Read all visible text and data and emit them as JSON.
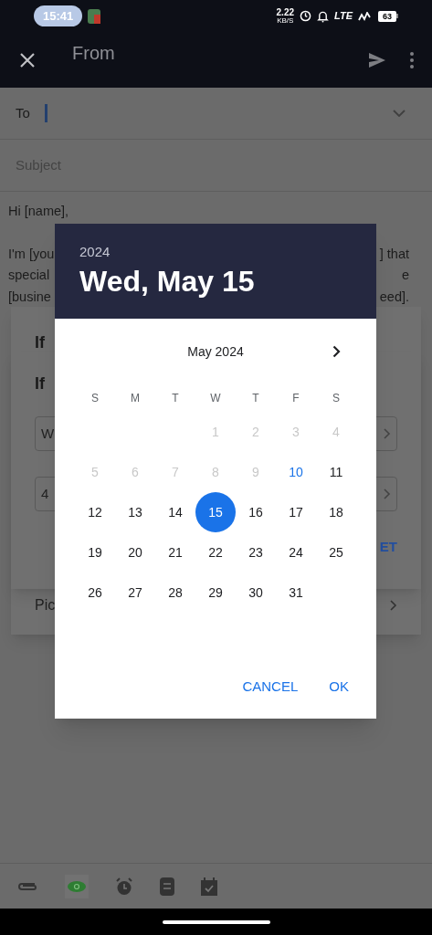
{
  "status_bar": {
    "time": "15:41",
    "speed": "2.22",
    "speed_unit": "KB/S",
    "network": "LTE",
    "battery": "63"
  },
  "app_bar": {
    "title": "From"
  },
  "compose": {
    "to_label": "To",
    "subject_placeholder": "Subject",
    "greeting": "Hi [name],",
    "body_lines": [
      {
        "left": "I'm [you",
        "right": "] that"
      },
      {
        "left": "special",
        "right": "e"
      },
      {
        "left": "[busine",
        "right": "eed]."
      }
    ]
  },
  "back_sheet": {
    "heading": "If",
    "row_label": "Pic"
  },
  "front_sheet": {
    "heading": "If",
    "fields": [
      "W",
      "4"
    ],
    "action": "ET"
  },
  "date_picker": {
    "year": "2024",
    "date": "Wed, May 15",
    "month": "May 2024",
    "weekdays": [
      "S",
      "M",
      "T",
      "W",
      "T",
      "F",
      "S"
    ],
    "weeks": [
      [
        {
          "kind": "blank"
        },
        {
          "kind": "blank"
        },
        {
          "kind": "blank"
        },
        {
          "day": "1",
          "kind": "disabled"
        },
        {
          "day": "2",
          "kind": "disabled"
        },
        {
          "day": "3",
          "kind": "disabled"
        },
        {
          "day": "4",
          "kind": "disabled"
        }
      ],
      [
        {
          "day": "5",
          "kind": "disabled"
        },
        {
          "day": "6",
          "kind": "disabled"
        },
        {
          "day": "7",
          "kind": "disabled"
        },
        {
          "day": "8",
          "kind": "disabled"
        },
        {
          "day": "9",
          "kind": "disabled"
        },
        {
          "day": "10",
          "kind": "today"
        },
        {
          "day": "11",
          "kind": "normal"
        }
      ],
      [
        {
          "day": "12",
          "kind": "normal"
        },
        {
          "day": "13",
          "kind": "normal"
        },
        {
          "day": "14",
          "kind": "normal"
        },
        {
          "day": "15",
          "kind": "selected"
        },
        {
          "day": "16",
          "kind": "normal"
        },
        {
          "day": "17",
          "kind": "normal"
        },
        {
          "day": "18",
          "kind": "normal"
        }
      ],
      [
        {
          "day": "19",
          "kind": "normal"
        },
        {
          "day": "20",
          "kind": "normal"
        },
        {
          "day": "21",
          "kind": "normal"
        },
        {
          "day": "22",
          "kind": "normal"
        },
        {
          "day": "23",
          "kind": "normal"
        },
        {
          "day": "24",
          "kind": "normal"
        },
        {
          "day": "25",
          "kind": "normal"
        }
      ],
      [
        {
          "day": "26",
          "kind": "normal"
        },
        {
          "day": "27",
          "kind": "normal"
        },
        {
          "day": "28",
          "kind": "normal"
        },
        {
          "day": "29",
          "kind": "normal"
        },
        {
          "day": "30",
          "kind": "normal"
        },
        {
          "day": "31",
          "kind": "normal"
        },
        {
          "kind": "blank"
        }
      ]
    ],
    "buttons": [
      "CANCEL",
      "OK"
    ]
  }
}
